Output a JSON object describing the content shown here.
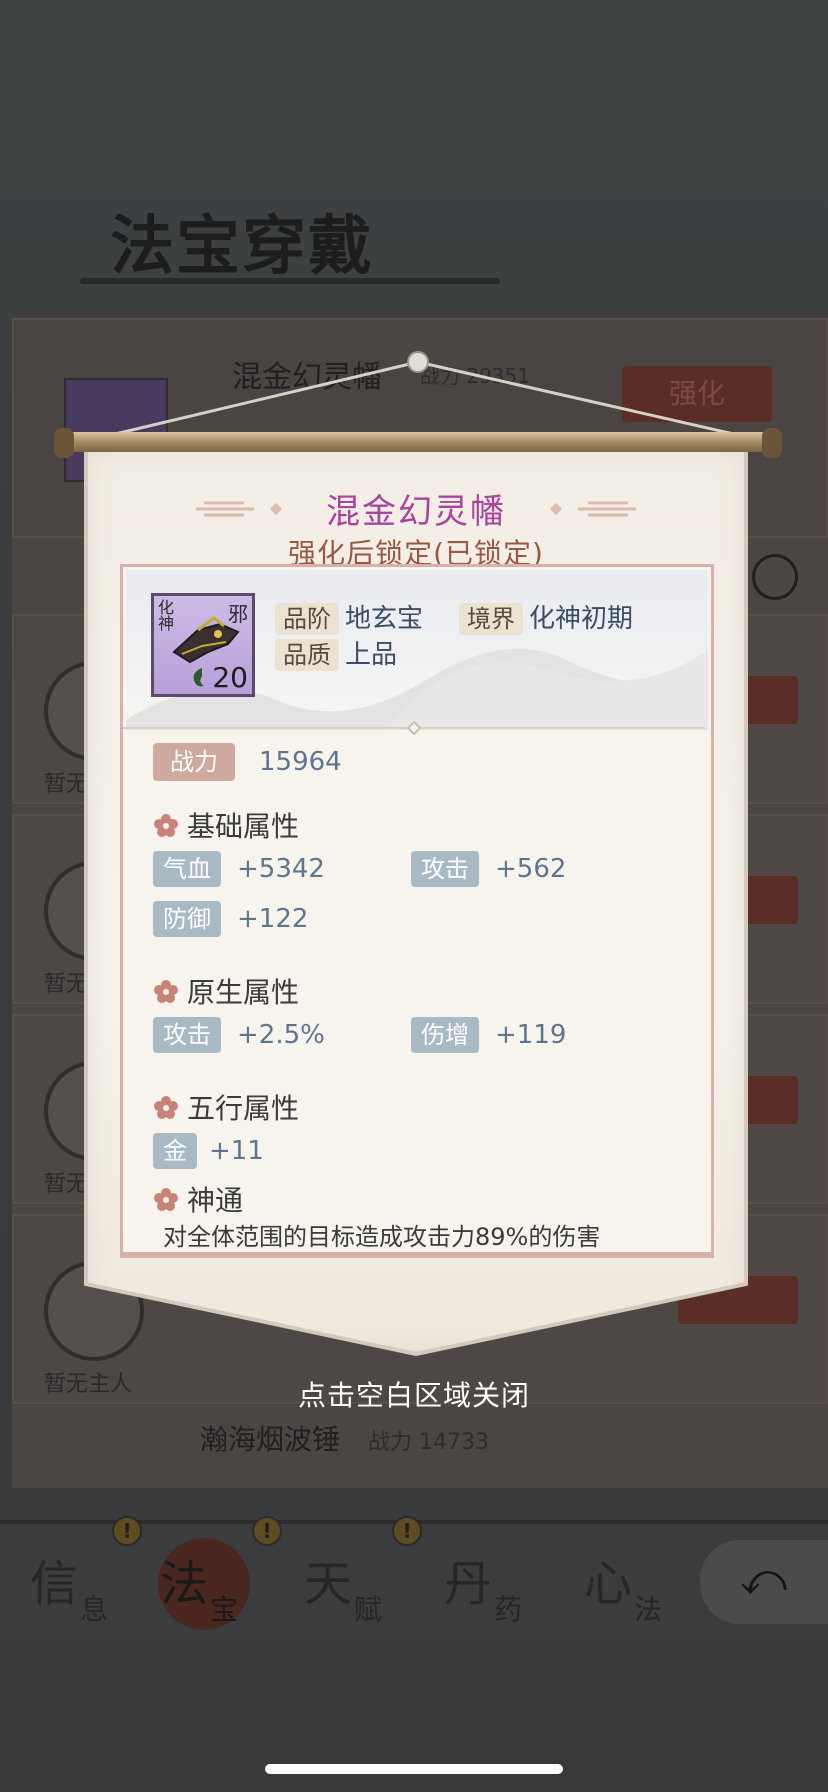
{
  "background": {
    "page_title": "法宝穿戴",
    "top_item": {
      "name": "混金幻灵幡",
      "power_label": "战力",
      "power_value": "29351",
      "enhance_label": "强化"
    },
    "slots": [
      {
        "owner": "暂无主人"
      },
      {
        "owner": "暂无主人"
      },
      {
        "owner": "暂无主人"
      },
      {
        "owner": "暂无主人"
      }
    ],
    "bottom_item": {
      "name": "瀚海烟波锤",
      "power_label": "战力",
      "power_value": "14733"
    }
  },
  "nav": {
    "tabs": [
      {
        "big": "信",
        "small": "息",
        "badge": "!"
      },
      {
        "big": "法",
        "small": "宝",
        "badge": "!"
      },
      {
        "big": "天",
        "small": "赋",
        "badge": "!"
      },
      {
        "big": "丹",
        "small": "药"
      },
      {
        "big": "心",
        "small": "法"
      }
    ]
  },
  "modal": {
    "item_name": "混金幻灵幡",
    "lock_status": "强化后锁定(已锁定)",
    "icon": {
      "corner_left": "化神",
      "corner_right": "邪",
      "level": "20"
    },
    "grade_label": "品阶",
    "grade_value": "地玄宝",
    "realm_label": "境界",
    "realm_value": "化神初期",
    "quality_label": "品质",
    "quality_value": "上品",
    "power_label": "战力",
    "power_value": "15964",
    "sections": {
      "base": "基础属性",
      "native": "原生属性",
      "elements": "五行属性",
      "skill": "神通"
    },
    "base_stats": [
      {
        "label": "气血",
        "value": "+5342"
      },
      {
        "label": "攻击",
        "value": "+562"
      },
      {
        "label": "防御",
        "value": "+122"
      }
    ],
    "native_stats": [
      {
        "label": "攻击",
        "value": "+2.5%"
      },
      {
        "label": "伤增",
        "value": "+119"
      }
    ],
    "element_stats": [
      {
        "label": "金",
        "value": "+11"
      }
    ],
    "skill_desc": "对全体范围的目标造成攻击力89%的伤害",
    "close_hint": "点击空白区域关闭"
  },
  "colors": {
    "item_name": "#a9449d",
    "lock_status": "#9b5744",
    "stat_tag": "#a9bac5",
    "stat_value": "#5e7590",
    "power_tag": "#cfa99d"
  }
}
